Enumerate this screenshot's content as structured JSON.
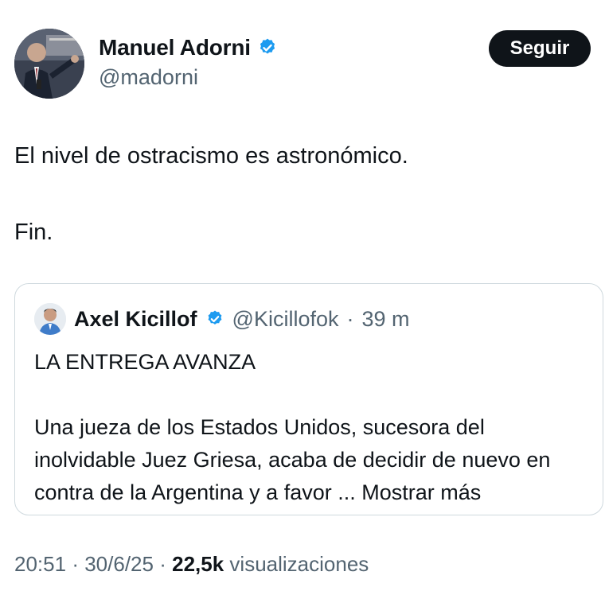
{
  "author": {
    "name": "Manuel Adorni",
    "handle": "@madorni",
    "verified_icon": "verified-badge-icon",
    "follow_label": "Seguir"
  },
  "tweet": {
    "paragraphs": [
      "El nivel de ostracismo es astronómico.",
      "Fin."
    ]
  },
  "quote": {
    "name": "Axel Kicillof",
    "handle": "@Kicillofok",
    "separator": "·",
    "time": "39 m",
    "title": "LA ENTREGA AVANZA",
    "body": "Una jueza de los Estados Unidos, sucesora del inolvidable Juez Griesa, acaba de decidir de nuevo en contra de la Argentina y a favor ...",
    "more_label": "Mostrar más"
  },
  "meta": {
    "time": "20:51",
    "separator": "·",
    "date": "30/6/25",
    "views_count": "22,5k",
    "views_label": "visualizaciones"
  },
  "colors": {
    "text": "#0f1419",
    "secondary": "#536471",
    "verified": "#1d9bf0",
    "border": "#cfd9de",
    "button_bg": "#0f1419"
  }
}
